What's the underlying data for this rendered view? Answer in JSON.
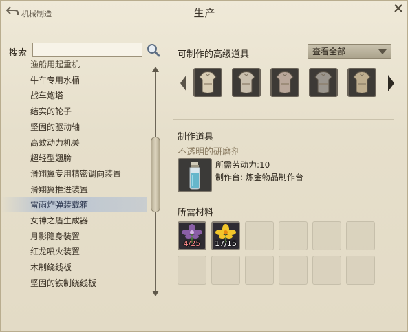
{
  "window": {
    "title": "生产",
    "breadcrumb": "机械制造"
  },
  "search": {
    "label": "搜索",
    "value": "",
    "placeholder": ""
  },
  "recipe_list": {
    "items": [
      {
        "label": "渔船用起重机",
        "partial": true
      },
      {
        "label": "牛车专用水桶"
      },
      {
        "label": "战车炮塔"
      },
      {
        "label": "结实的轮子"
      },
      {
        "label": "坚固的驱动轴"
      },
      {
        "label": "高效动力机关"
      },
      {
        "label": "超轻型翅膀"
      },
      {
        "label": "滑翔翼专用精密调向装置"
      },
      {
        "label": "滑翔翼推进装置"
      },
      {
        "label": "雷雨炸弹装载箱",
        "selected": true
      },
      {
        "label": "女神之盾生成器"
      },
      {
        "label": "月影隐身装置"
      },
      {
        "label": "红龙喷火装置"
      },
      {
        "label": "木制绕线板"
      },
      {
        "label": "坚固的铁制绕线板"
      }
    ]
  },
  "advanced": {
    "title": "可制作的高级道具",
    "filter_selected": "查看全部",
    "items": [
      {
        "icon": "armor-icon",
        "color": "#d8cdb4"
      },
      {
        "icon": "armor-icon",
        "color": "#c9bfae"
      },
      {
        "icon": "armor-icon",
        "color": "#b9a79a"
      },
      {
        "icon": "armor-icon",
        "color": "#9a958d"
      },
      {
        "icon": "armor-icon",
        "color": "#bfae8f"
      }
    ]
  },
  "craft": {
    "title": "制作道具",
    "item_name": "不透明的研磨剂",
    "labor_label": "所需劳动力:10",
    "station_label": "制作台:",
    "station_value": "炼金物品制作台",
    "icon": "potion-bottle-icon"
  },
  "materials": {
    "title": "所需材料",
    "items": [
      {
        "icon": "purple-flower-icon",
        "count": "4/25",
        "short": true
      },
      {
        "icon": "yellow-flower-icon",
        "count": "17/15",
        "short": false
      }
    ],
    "empty_slots": 10
  },
  "colors": {
    "selected_row": "#b2c0d4",
    "accent_text": "#8c7d63"
  }
}
